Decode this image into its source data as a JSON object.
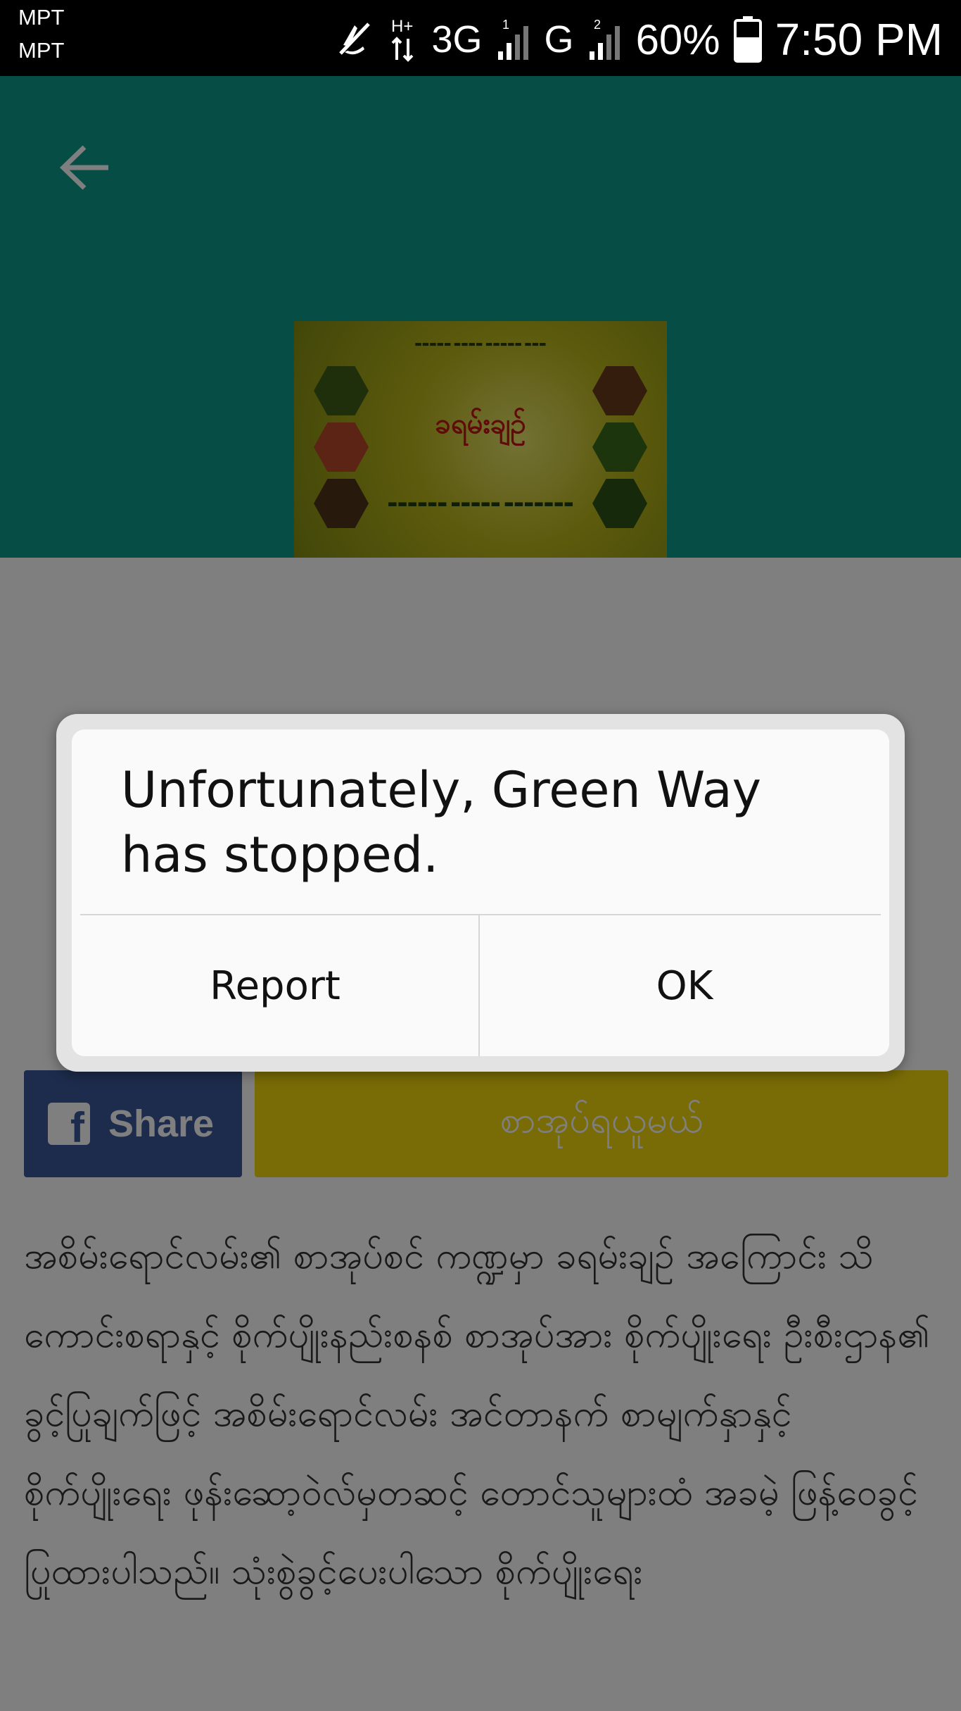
{
  "status_bar": {
    "carrier_1": "MPT",
    "carrier_2": "MPT",
    "network_1": "3G",
    "network_2": "G",
    "battery_percent": "60%",
    "time": "7:50 PM",
    "icons": [
      "mute-icon",
      "data-arrows-icon",
      "signal-sim1-icon",
      "signal-sim2-icon",
      "battery-icon"
    ]
  },
  "header": {
    "background": "#0d9a8c",
    "back_icon": "arrow-left-icon"
  },
  "book": {
    "cover_title": "ခရမ်းချဉ်"
  },
  "actions": {
    "share_label": "Share",
    "share_icon": "facebook-icon",
    "share_color": "#3b5998",
    "order_label": "စာအုပ်ရယူမယ်",
    "order_color": "#f2d70c"
  },
  "description": "အစိမ်းရောင်လမ်း၏ စာအုပ်စင် ကဏ္ဍမှာ ခရမ်းချဉ် အကြောင်း သိကောင်းစရာနှင့် စိုက်ပျိုးနည်းစနစ် စာအုပ်အား စိုက်ပျိုးရေး ဦးစီးဌာန၏ ခွင့်ပြုချက်ဖြင့် အစိမ်းရောင်လမ်း အင်တာနက် စာမျက်နှာနှင့် စိုက်ပျိုးရေး ဖုန်းဆော့ဝဲလ်မှတဆင့် တောင်သူများထံ အခမဲ့ ဖြန့်ဝေခွင့် ပြုထားပါသည်။ သုံးစွဲခွင့်ပေးပါသော စိုက်ပျိုးရေး",
  "dialog": {
    "message": "Unfortunately, Green Way has stopped.",
    "report_label": "Report",
    "ok_label": "OK"
  }
}
